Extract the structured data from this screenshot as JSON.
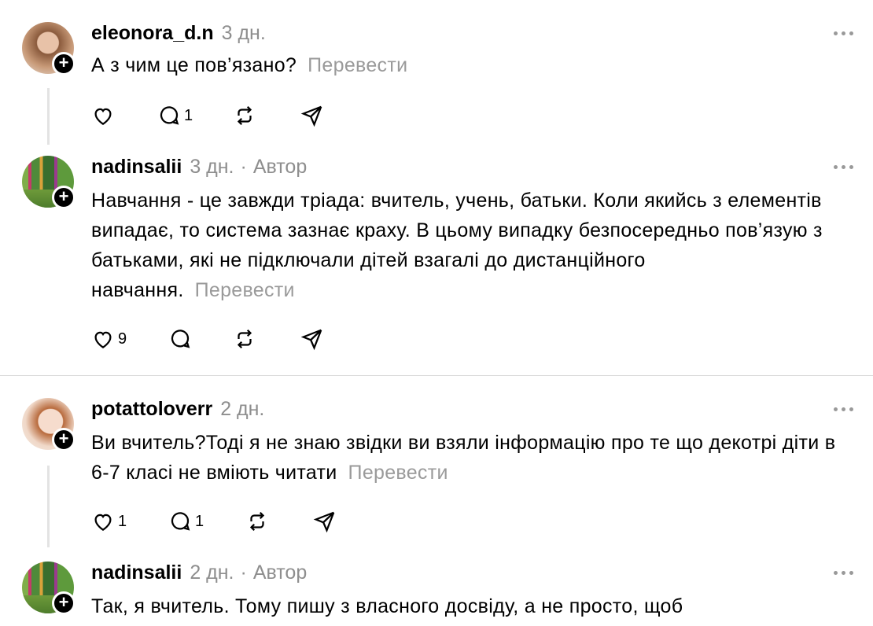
{
  "comments": [
    {
      "username": "eleonora_d.n",
      "time": "3 дн.",
      "author_badge": "",
      "text": "А з чим це пов’язано?",
      "translate": "Перевести",
      "likes": "",
      "replies": "1",
      "avatar": "girl-photo"
    },
    {
      "username": "nadinsalii",
      "time": "3 дн.",
      "author_badge": "Автор",
      "text": "Навчання - це завжди тріада: вчитель, учень, батьки. Коли якийсь з елементів випадає, то система зазнає краху. В цьому випадку безпосередньо пов’язую з батьками, які не підключали дітей взагалі до дистанційного навчання.",
      "translate": "Перевести",
      "likes": "9",
      "replies": "",
      "avatar": "forest-photo"
    },
    {
      "username": "potattoloverr",
      "time": "2 дн.",
      "author_badge": "",
      "text": "Ви вчитель?Тоді я не знаю звідки ви взяли інформацію про те що декотрі діти в 6-7 класі не вміють читати",
      "translate": "Перевести",
      "likes": "1",
      "replies": "1",
      "avatar": "anime-avatar"
    },
    {
      "username": "nadinsalii",
      "time": "2 дн.",
      "author_badge": "Автор",
      "text": "Так, я вчитель. Тому пишу з власного досвіду, а не просто, щоб",
      "translate": "",
      "likes": "",
      "replies": "",
      "avatar": "forest-photo"
    }
  ],
  "icons": {
    "like": "heart-icon",
    "reply": "comment-icon",
    "repost": "repost-icon",
    "share": "send-icon",
    "more": "more-icon",
    "follow": "plus-icon"
  }
}
